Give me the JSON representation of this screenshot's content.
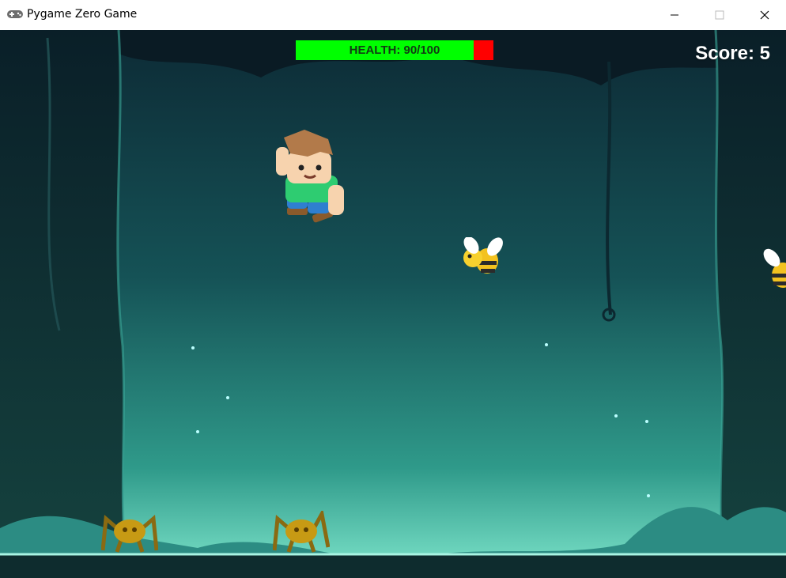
{
  "window": {
    "title": "Pygame Zero Game",
    "app_icon": "gamepad-icon",
    "controls": [
      "minimize-icon",
      "maximize-icon",
      "close-icon"
    ]
  },
  "hud": {
    "health_label": "HEALTH: 90/100",
    "health_value": 90,
    "health_max": 100,
    "health_fraction": 0.9,
    "score_label": "Score: 5"
  },
  "sprites": [
    "player-character",
    "bee-enemy",
    "bee-enemy",
    "spider-enemy",
    "spider-enemy"
  ],
  "colors": {
    "health_fill": "#00ff00",
    "health_empty": "#ff0000",
    "score_text": "#ffffff"
  }
}
